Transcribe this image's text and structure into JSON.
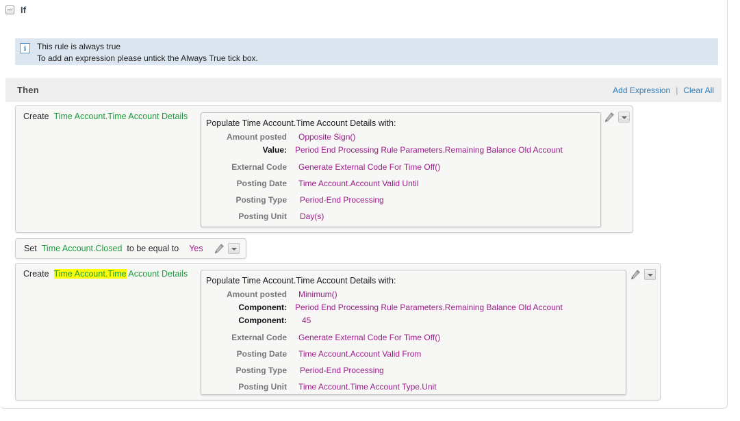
{
  "if_section": {
    "collapse_icon": "minus-box-icon",
    "label": "If",
    "info": {
      "icon": "info-icon",
      "line1": "This rule is always true",
      "line2": "To add an expression please untick the Always True tick box."
    }
  },
  "then_section": {
    "label": "Then",
    "add_expression_label": "Add Expression",
    "separator": "|",
    "clear_all_label": "Clear All"
  },
  "colors": {
    "entity_green": "#1f9b3f",
    "value_purple": "#9c1d8a",
    "link_blue": "#2e7ab8",
    "highlight_yellow": "#ffff00",
    "info_bg": "#dce6f1",
    "band_bg": "#eeeeee",
    "card_bg": "#f7f7f5"
  },
  "actions": [
    {
      "type": "create",
      "keyword": "Create",
      "entity": "Time Account.Time Account Details",
      "entity_highlight": "",
      "entity_rest": "Time Account.Time Account Details",
      "panel_title": "Populate Time Account.Time Account Details with:",
      "rows": [
        {
          "label": "Amount posted",
          "value": "Opposite Sign()"
        },
        {
          "sub_label": "Value:",
          "sub_value": "Period End Processing Rule Parameters.Remaining Balance Old Account"
        },
        {
          "label": "External Code",
          "value": "Generate External Code For Time Off()"
        },
        {
          "label": "Posting Date",
          "value": "Time Account.Account Valid Until"
        },
        {
          "label": "Posting Type",
          "value": "Period-End Processing"
        },
        {
          "label": "Posting Unit",
          "value": "Day(s)"
        }
      ],
      "edit_icon": "pencil-icon",
      "dropdown_icon": "chevron-down-icon"
    },
    {
      "type": "set",
      "keyword": "Set",
      "entity": "Time Account.Closed",
      "operator": "to be equal to",
      "value": "Yes",
      "edit_icon": "pencil-icon",
      "dropdown_icon": "chevron-down-icon"
    },
    {
      "type": "create",
      "keyword": "Create",
      "entity": "Time Account.Time Account Details",
      "entity_highlight": "Time Account.Time",
      "entity_rest": " Account Details",
      "panel_title": "Populate Time Account.Time Account Details with:",
      "rows": [
        {
          "label": "Amount posted",
          "value": "Minimum()"
        },
        {
          "sub_label": "Component:",
          "sub_value": "Period End Processing Rule Parameters.Remaining Balance Old Account"
        },
        {
          "sub_label": "Component:",
          "sub_value": "45"
        },
        {
          "label": "External Code",
          "value": "Generate External Code For Time Off()"
        },
        {
          "label": "Posting Date",
          "value": "Time Account.Account Valid From"
        },
        {
          "label": "Posting Type",
          "value": "Period-End Processing"
        },
        {
          "label": "Posting Unit",
          "value": "Time Account.Time Account Type.Unit"
        }
      ],
      "edit_icon": "pencil-icon",
      "dropdown_icon": "chevron-down-icon"
    }
  ]
}
